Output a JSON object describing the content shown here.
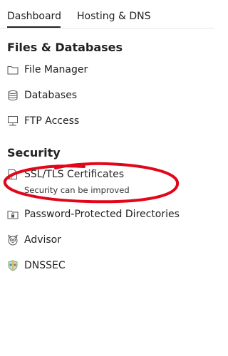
{
  "tabs": [
    {
      "label": "Dashboard",
      "active": true
    },
    {
      "label": "Hosting & DNS",
      "active": false
    }
  ],
  "sections": {
    "files": {
      "title": "Files & Databases",
      "items": [
        {
          "label": "File Manager",
          "icon": "folder-icon"
        },
        {
          "label": "Databases",
          "icon": "database-icon"
        },
        {
          "label": "FTP Access",
          "icon": "ftp-icon"
        }
      ]
    },
    "security": {
      "title": "Security",
      "items": [
        {
          "label": "SSL/TLS Certificates",
          "icon": "certificate-icon",
          "status": "Security can be improved"
        },
        {
          "label": "Password-Protected Directories",
          "icon": "locked-folder-icon"
        },
        {
          "label": "Advisor",
          "icon": "advisor-icon"
        },
        {
          "label": "DNSSEC",
          "icon": "dnssec-icon"
        }
      ]
    }
  },
  "colors": {
    "text": "#222222",
    "annotation": "#e1061a",
    "divider": "#e3e3e3"
  }
}
